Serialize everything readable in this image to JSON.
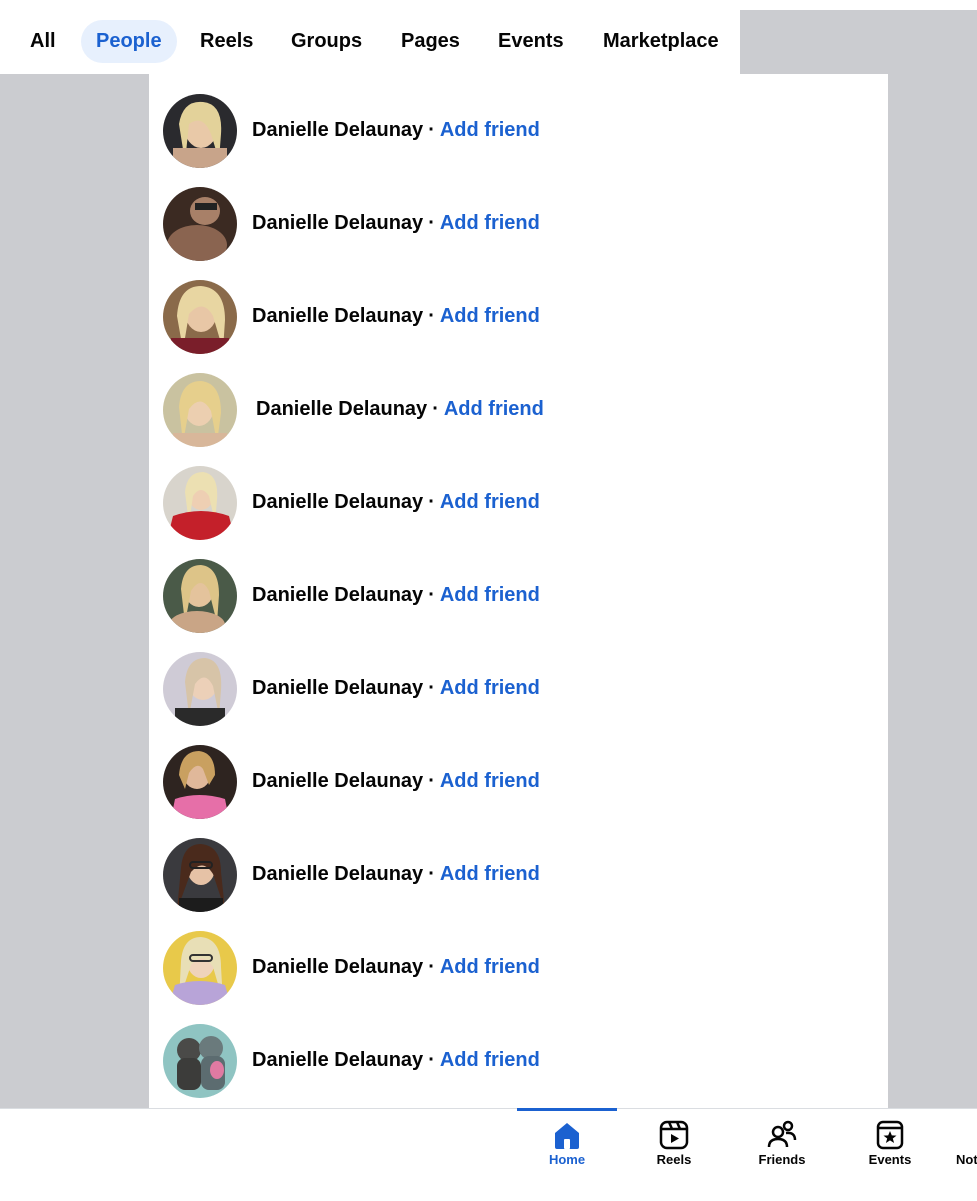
{
  "tabs": [
    {
      "label": "All"
    },
    {
      "label": "People"
    },
    {
      "label": "Reels"
    },
    {
      "label": "Groups"
    },
    {
      "label": "Pages"
    },
    {
      "label": "Events"
    },
    {
      "label": "Marketplace"
    }
  ],
  "active_tab": "People",
  "results": [
    {
      "name": "Danielle Delaunay",
      "separator": "·",
      "action": "Add friend"
    },
    {
      "name": "Danielle Delaunay",
      "separator": "·",
      "action": "Add friend"
    },
    {
      "name": "Danielle Delaunay",
      "separator": "·",
      "action": "Add friend"
    },
    {
      "name": "Danielle Delaunay",
      "separator": "·",
      "action": "Add friend"
    },
    {
      "name": "Danielle Delaunay",
      "separator": "·",
      "action": "Add friend"
    },
    {
      "name": "Danielle Delaunay",
      "separator": "·",
      "action": "Add friend"
    },
    {
      "name": "Danielle Delaunay",
      "separator": "·",
      "action": "Add friend"
    },
    {
      "name": "Danielle Delaunay",
      "separator": "·",
      "action": "Add friend"
    },
    {
      "name": "Danielle Delaunay",
      "separator": "·",
      "action": "Add friend"
    },
    {
      "name": "Danielle Delaunay",
      "separator": "·",
      "action": "Add friend"
    },
    {
      "name": "Danielle Delaunay",
      "separator": "·",
      "action": "Add friend"
    }
  ],
  "bottom_nav": [
    {
      "label": "Home",
      "icon": "home-icon",
      "active": true
    },
    {
      "label": "Reels",
      "icon": "reels-icon",
      "active": false
    },
    {
      "label": "Friends",
      "icon": "friends-icon",
      "active": false
    },
    {
      "label": "Events",
      "icon": "events-icon",
      "active": false
    },
    {
      "label": "Not",
      "icon": "notifications-icon",
      "active": false
    }
  ],
  "colors": {
    "accent": "#1b61d0",
    "active_tab_bg": "#e7f0fd",
    "page_bg_gray": "#cbccd0",
    "text": "#050505"
  }
}
